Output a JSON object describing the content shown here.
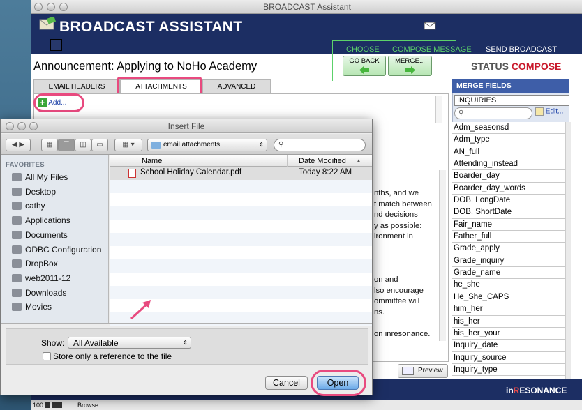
{
  "window": {
    "title": "BROADCAST Assistant",
    "app_title": "BROADCAST ASSISTANT",
    "steps": [
      {
        "label": "CHOOSE",
        "color": "#5cd16a"
      },
      {
        "label": "COMPOSE MESSAGE",
        "color": "#5cd16a"
      },
      {
        "label": "SEND BROADCAST",
        "color": "#ffffff"
      }
    ],
    "announcement": "Announcement: Applying to NoHo Academy",
    "go_back": "GO BACK",
    "merge": "MERGE...",
    "status_label": "STATUS",
    "status_value": "COMPOSE",
    "tabs": [
      "EMAIL HEADERS",
      "ATTACHMENTS",
      "ADVANCED"
    ],
    "add_label": "Add...",
    "body_lines": [
      "nths, and we",
      "t match between",
      "nd decisions",
      "y as possible:",
      "ironment in",
      "",
      "",
      "",
      "on and",
      "lso encourage",
      "ommittee will",
      "ns.",
      "",
      "on inresonance."
    ],
    "preview_label": "Preview",
    "brand_in": "in",
    "brand_res": "R",
    "brand_rest": "ESONANCE",
    "statusbar": {
      "zoom": "100",
      "mode": "Browse"
    }
  },
  "merge_fields": {
    "title": "MERGE FIELDS",
    "selected": "INQUIRIES",
    "edit": "Edit...",
    "items": [
      "Adm_seasonsd",
      "Adm_type",
      "AN_full",
      "Attending_instead",
      "Boarder_day",
      "Boarder_day_words",
      "DOB, LongDate",
      "DOB, ShortDate",
      "Fair_name",
      "Father_full",
      "Grade_apply",
      "Grade_inquiry",
      "Grade_name",
      "he_she",
      "He_She_CAPS",
      "him_her",
      "his_her",
      "his_her_your",
      "Inquiry_date",
      "Inquiry_source",
      "Inquiry_type"
    ]
  },
  "dialog": {
    "title": "Insert File",
    "location": "email attachments",
    "favorites_label": "FAVORITES",
    "favorites": [
      {
        "label": "All My Files",
        "icon": "all-files-icon"
      },
      {
        "label": "Desktop",
        "icon": "desktop-icon"
      },
      {
        "label": "cathy",
        "icon": "home-icon"
      },
      {
        "label": "Applications",
        "icon": "applications-icon"
      },
      {
        "label": "Documents",
        "icon": "documents-icon"
      },
      {
        "label": "ODBC Configuration",
        "icon": "folder-icon"
      },
      {
        "label": "DropBox",
        "icon": "folder-icon"
      },
      {
        "label": "web2011-12",
        "icon": "folder-icon"
      },
      {
        "label": "Downloads",
        "icon": "downloads-icon"
      },
      {
        "label": "Movies",
        "icon": "movies-icon"
      }
    ],
    "columns": [
      "Name",
      "Date Modified"
    ],
    "files": [
      {
        "name": "School Holiday Calendar.pdf",
        "date": "Today 8:22 AM"
      }
    ],
    "show_label": "Show:",
    "show_value": "All Available",
    "store_ref_label": "Store only a reference to the file",
    "cancel": "Cancel",
    "open": "Open"
  }
}
